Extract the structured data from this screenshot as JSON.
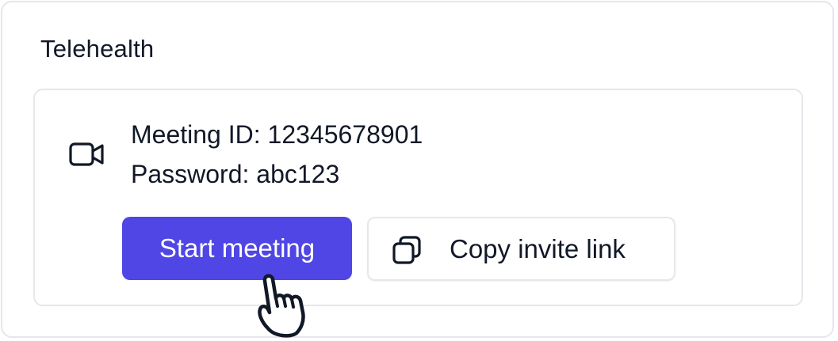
{
  "card": {
    "title": "Telehealth"
  },
  "meeting": {
    "icon": "video-camera-icon",
    "meeting_id_text": "Meeting ID: 12345678901",
    "password_text": "Password: abc123"
  },
  "actions": {
    "start_label": "Start meeting",
    "copy_label": "Copy invite link",
    "copy_icon": "copy-icon"
  },
  "cursor": {
    "type": "hand-pointer-icon"
  },
  "colors": {
    "accent": "#4f46e5",
    "border": "#e5e7eb",
    "text": "#111827"
  }
}
